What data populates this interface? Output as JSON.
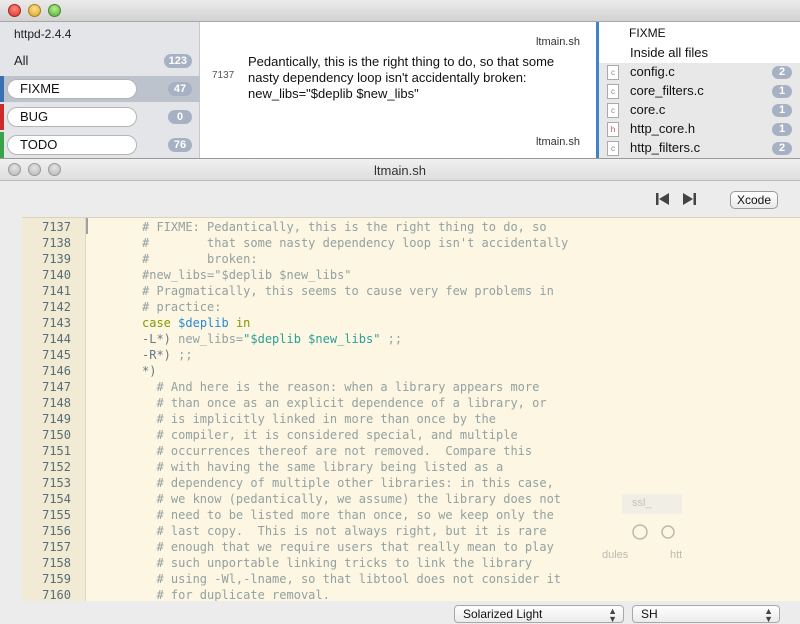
{
  "back_window": {
    "project": "httpd-2.4.4",
    "tags": [
      {
        "label": "All",
        "count": "123",
        "color": ""
      },
      {
        "label": "FIXME",
        "count": "47",
        "color": "#3a6fb0"
      },
      {
        "label": "BUG",
        "count": "0",
        "color": "#cc2b2b"
      },
      {
        "label": "TODO",
        "count": "76",
        "color": "#3aa34a"
      }
    ],
    "snippet": {
      "file_top": "ltmain.sh",
      "line": "7137",
      "text": "Pedantically, this is the right thing to do, so that some nasty dependency loop isn't accidentally broken: new_libs=\"$deplib $new_libs\"",
      "file_bottom": "ltmain.sh"
    },
    "files": {
      "title": "FIXME",
      "inside_all": "Inside all files",
      "items": [
        {
          "name": "config.c",
          "icon": "c",
          "count": "2"
        },
        {
          "name": "core_filters.c",
          "icon": "c",
          "count": "1"
        },
        {
          "name": "core.c",
          "icon": "c",
          "count": "1"
        },
        {
          "name": "http_core.h",
          "icon": "h",
          "count": "1"
        },
        {
          "name": "http_filters.c",
          "icon": "c",
          "count": "2"
        }
      ]
    }
  },
  "front_window": {
    "title": "ltmain.sh",
    "xcode_label": "Xcode",
    "theme": "Solarized Light",
    "language": "SH"
  },
  "editor": {
    "line_numbers": [
      "7137",
      "7138",
      "7139",
      "7140",
      "7141",
      "7142",
      "7143",
      "7144",
      "7145",
      "7146",
      "7147",
      "7148",
      "7149",
      "7150",
      "7151",
      "7152",
      "7153",
      "7154",
      "7155",
      "7156",
      "7157",
      "7158",
      "7159",
      "7160"
    ],
    "lines": [
      "# FIXME: Pedantically, this is the right thing to do, so",
      "#        that some nasty dependency loop isn't accidentally",
      "#        broken:",
      "#new_libs=\"$deplib $new_libs\"",
      "# Pragmatically, this seems to cause very few problems in",
      "# practice:",
      "case $deplib in",
      "-L*) new_libs=\"$deplib $new_libs\" ;;",
      "-R*) ;;",
      "*)",
      "  # And here is the reason: when a library appears more",
      "  # than once as an explicit dependence of a library, or",
      "  # is implicitly linked in more than once by the",
      "  # compiler, it is considered special, and multiple",
      "  # occurrences thereof are not removed.  Compare this",
      "  # with having the same library being listed as a",
      "  # dependency of multiple other libraries: in this case,",
      "  # we know (pedantically, we assume) the library does not",
      "  # need to be listed more than once, so we keep only the",
      "  # last copy.  This is not always right, but it is rare",
      "  # enough that we require users that really mean to play",
      "  # such unportable linking tricks to link the library",
      "  # using -Wl,-lname, so that libtool does not consider it",
      "  # for duplicate removal."
    ]
  },
  "ghost": {
    "text1": "ssl_",
    "text2": "dules",
    "text3": "htt"
  }
}
